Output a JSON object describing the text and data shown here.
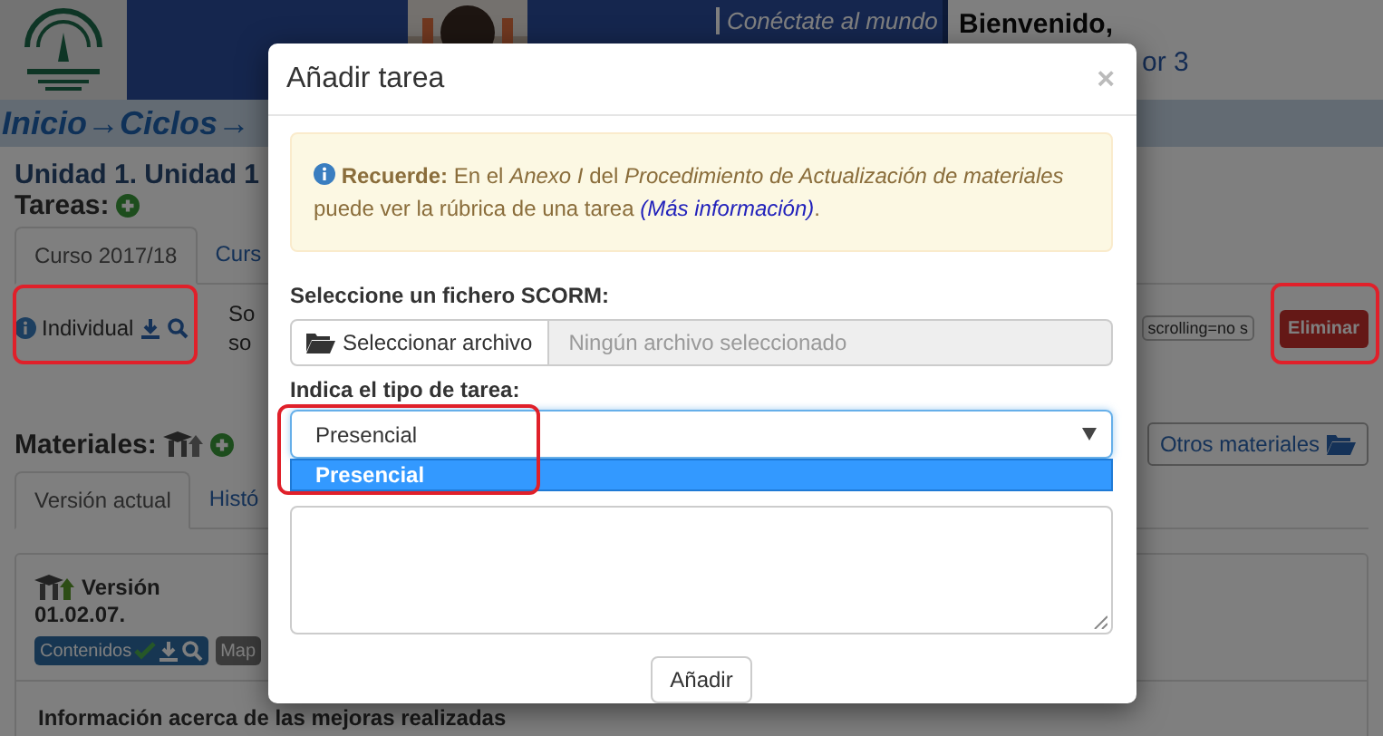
{
  "header": {
    "banner_text": "Conéctate al mundo",
    "welcome": "Bienvenido,",
    "user_fragment": "or 3"
  },
  "breadcrumb": "Inicio→Ciclos→",
  "unit_title": "Unidad 1. Unidad 1",
  "tasks": {
    "label": "Tareas:",
    "tabs": [
      {
        "label": "Curso 2017/18",
        "selected": true
      },
      {
        "label": "Curs",
        "selected": false
      }
    ],
    "task": {
      "type": "Individual",
      "description": [
        "So",
        "so"
      ],
      "embed_code": "scrolling=no s",
      "delete_button": "Eliminar"
    }
  },
  "materials": {
    "label": "Materiales:",
    "other_button": "Otros materiales",
    "tabs": [
      {
        "label": "Versión actual",
        "selected": true
      },
      {
        "label": "Histó",
        "selected": false
      }
    ],
    "version_label": "Versión",
    "version_number": "01.02.07.",
    "badges": [
      {
        "label": "Contenidos",
        "kind": "contents"
      },
      {
        "label": "Map",
        "kind": "plain"
      }
    ],
    "info_heading": "Información acerca de las mejoras realizadas"
  },
  "modal": {
    "title": "Añadir tarea",
    "close": "×",
    "alert": {
      "text": "**Recuerde:** En el *Anexo I* del *Procedimiento de Actualización de materiales* puede ver la rúbrica de una tarea ",
      "link": "(Más información)",
      "after": "."
    },
    "file_label": "Seleccione un fichero SCORM:",
    "file_button": "Seleccionar archivo",
    "file_placeholder": "Ningún archivo seleccionado",
    "type_label": "Indica el tipo de tarea:",
    "select_value": "Presencial",
    "options": [
      {
        "label": "Presencial",
        "selected": true
      }
    ],
    "submit": "Añadir"
  }
}
